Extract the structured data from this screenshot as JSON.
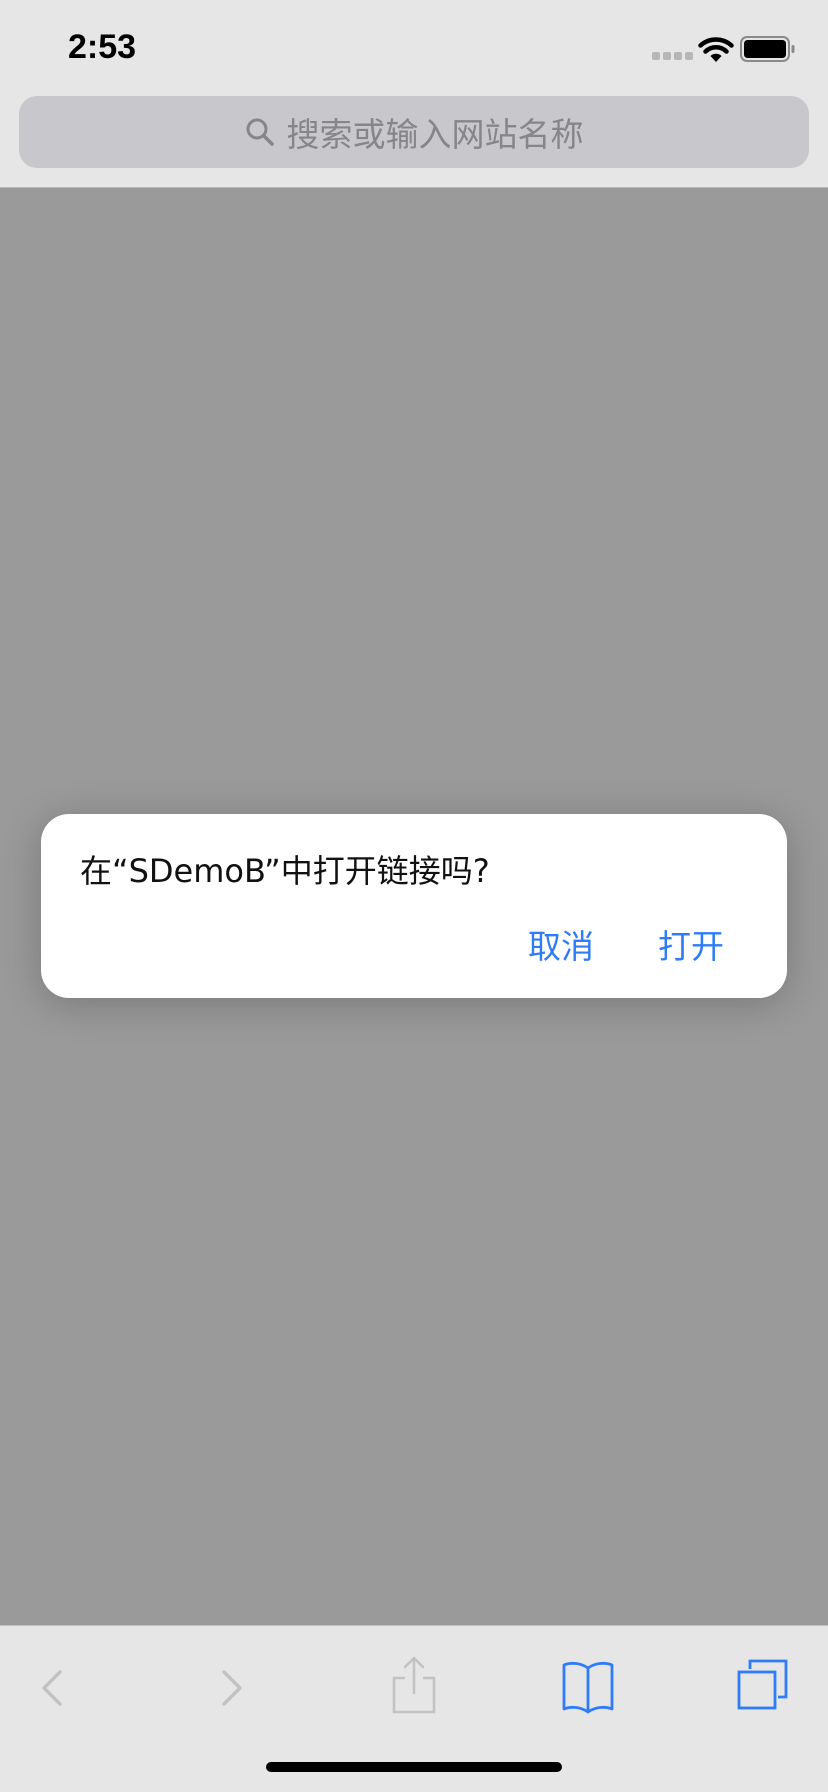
{
  "status_bar": {
    "time": "2:53",
    "icons": [
      "signal-icon",
      "wifi-icon",
      "battery-icon"
    ]
  },
  "address_bar": {
    "placeholder": "搜索或输入网站名称",
    "icon": "search-icon"
  },
  "alert": {
    "message": "在“SDemoB”中打开链接吗?",
    "cancel_label": "取消",
    "open_label": "打开"
  },
  "toolbar": {
    "items": [
      "back-icon",
      "forward-icon",
      "share-icon",
      "bookmarks-icon",
      "tabs-icon"
    ]
  },
  "colors": {
    "accent": "#2f7cf6",
    "dim_overlay": "#9a9a9a",
    "bar_background": "#e6e6e6",
    "disabled_icon": "#c2c2c2"
  }
}
